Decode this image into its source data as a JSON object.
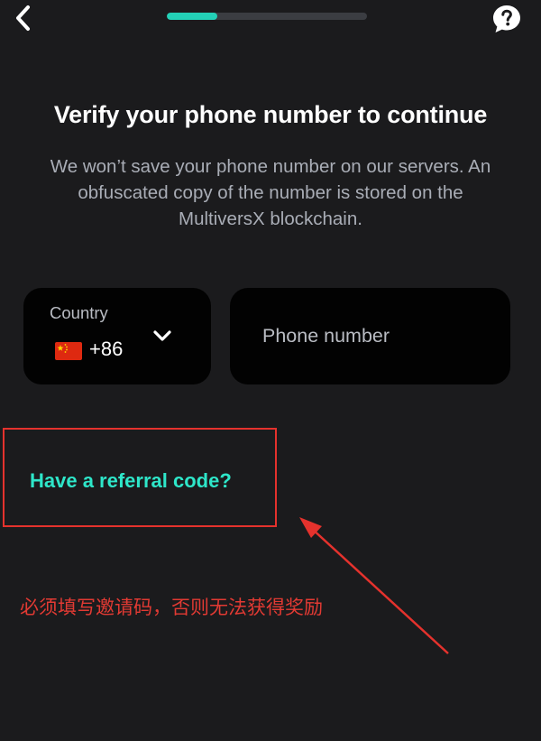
{
  "progress": {
    "fraction": 0.25
  },
  "header": {
    "back_icon": "chevron-left-icon",
    "help_icon": "help-chat-icon"
  },
  "title": "Verify your phone number to continue",
  "subtitle": "We won’t save your phone number on our servers. An obfuscated copy of the number is stored on the MultiversX blockchain.",
  "country_selector": {
    "label": "Country",
    "flag": "china-flag-icon",
    "dial_code": "+86",
    "chevron_icon": "chevron-down-icon"
  },
  "phone_field": {
    "value": "",
    "placeholder": "Phone number"
  },
  "referral": {
    "link_label": "Have a referral code?"
  },
  "annotation": {
    "text": "必须填写邀请码，否则无法获得奖励",
    "color": "#e5322d"
  },
  "colors": {
    "background": "#1b1b1d",
    "accent": "#23d1b7",
    "link": "#2ee6c9",
    "field_background": "#020202"
  }
}
